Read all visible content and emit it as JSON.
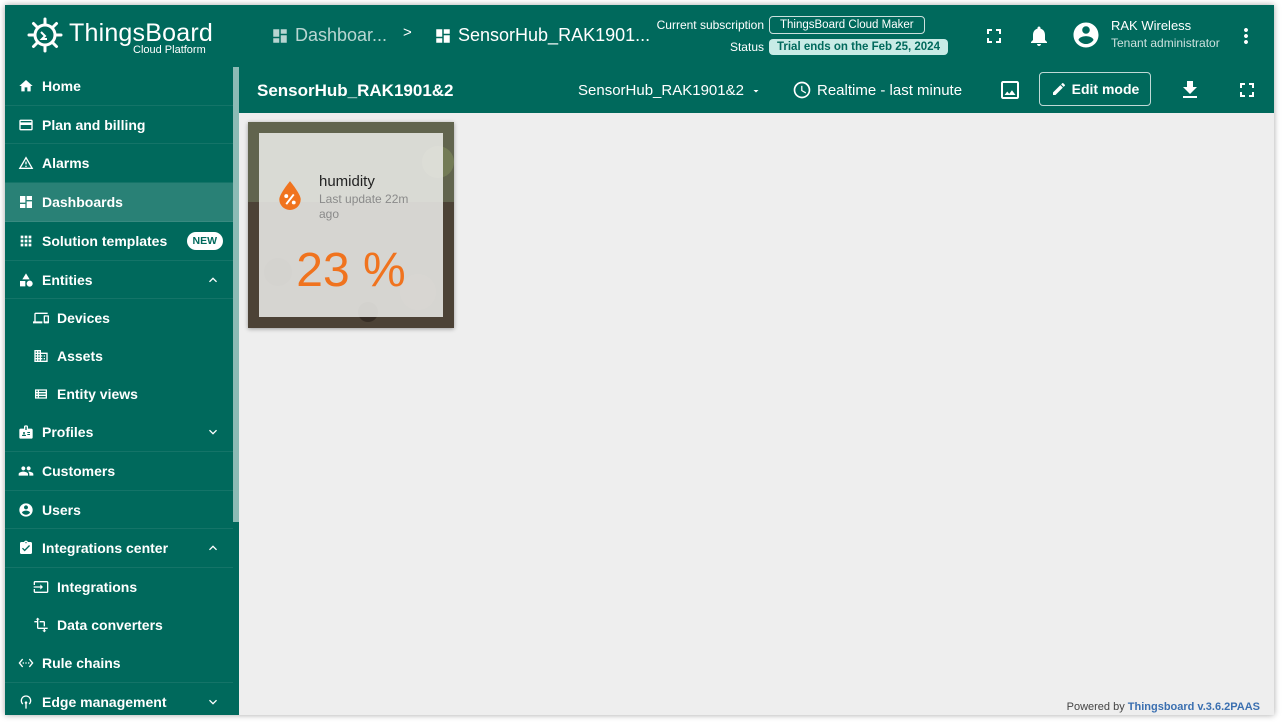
{
  "header": {
    "logo_title": "ThingsBoard",
    "logo_subtitle": "Cloud Platform",
    "breadcrumb": [
      {
        "label": "Dashboar..."
      },
      {
        "label": "SensorHub_RAK1901..."
      }
    ],
    "breadcrumb_separator": ">",
    "subscription_label": "Current subscription",
    "subscription_value": "ThingsBoard Cloud Maker",
    "status_label": "Status",
    "status_value": "Trial ends on the Feb 25, 2024",
    "user_name": "RAK Wireless",
    "user_role": "Tenant administrator"
  },
  "sidebar": {
    "items": [
      {
        "label": "Home",
        "icon": "home-icon"
      },
      {
        "label": "Plan and billing",
        "icon": "credit-card-icon"
      },
      {
        "label": "Alarms",
        "icon": "warning-icon"
      },
      {
        "label": "Dashboards",
        "icon": "dashboard-icon",
        "active": true
      },
      {
        "label": "Solution templates",
        "icon": "apps-grid-icon",
        "badge": "NEW"
      },
      {
        "label": "Entities",
        "icon": "category-icon",
        "expanded": true
      },
      {
        "label": "Devices",
        "icon": "devices-icon",
        "child": true
      },
      {
        "label": "Assets",
        "icon": "building-icon",
        "child": true
      },
      {
        "label": "Entity views",
        "icon": "view-list-icon",
        "child": true
      },
      {
        "label": "Profiles",
        "icon": "badge-icon",
        "expanded": false
      },
      {
        "label": "Customers",
        "icon": "people-icon"
      },
      {
        "label": "Users",
        "icon": "account-circle-icon"
      },
      {
        "label": "Integrations center",
        "icon": "integration-icon",
        "expanded": true
      },
      {
        "label": "Integrations",
        "icon": "input-icon",
        "child": true
      },
      {
        "label": "Data converters",
        "icon": "transform-icon",
        "child": true
      },
      {
        "label": "Rule chains",
        "icon": "settings-ethernet-icon"
      },
      {
        "label": "Edge management",
        "icon": "router-icon",
        "expanded": false
      }
    ]
  },
  "dashboard": {
    "title": "SensorHub_RAK1901&2",
    "state": "SensorHub_RAK1901&2",
    "timewindow": "Realtime - last minute",
    "edit_label": "Edit mode"
  },
  "widget": {
    "title": "humidity",
    "last_update": "Last update 22m ago",
    "value": "23 %",
    "value_color": "#f0731e"
  },
  "footer": {
    "powered_prefix": "Powered by",
    "powered_link": "Thingsboard v.3.6.2PAAS"
  },
  "colors": {
    "primary": "#00695c",
    "accent": "#f0731e"
  }
}
